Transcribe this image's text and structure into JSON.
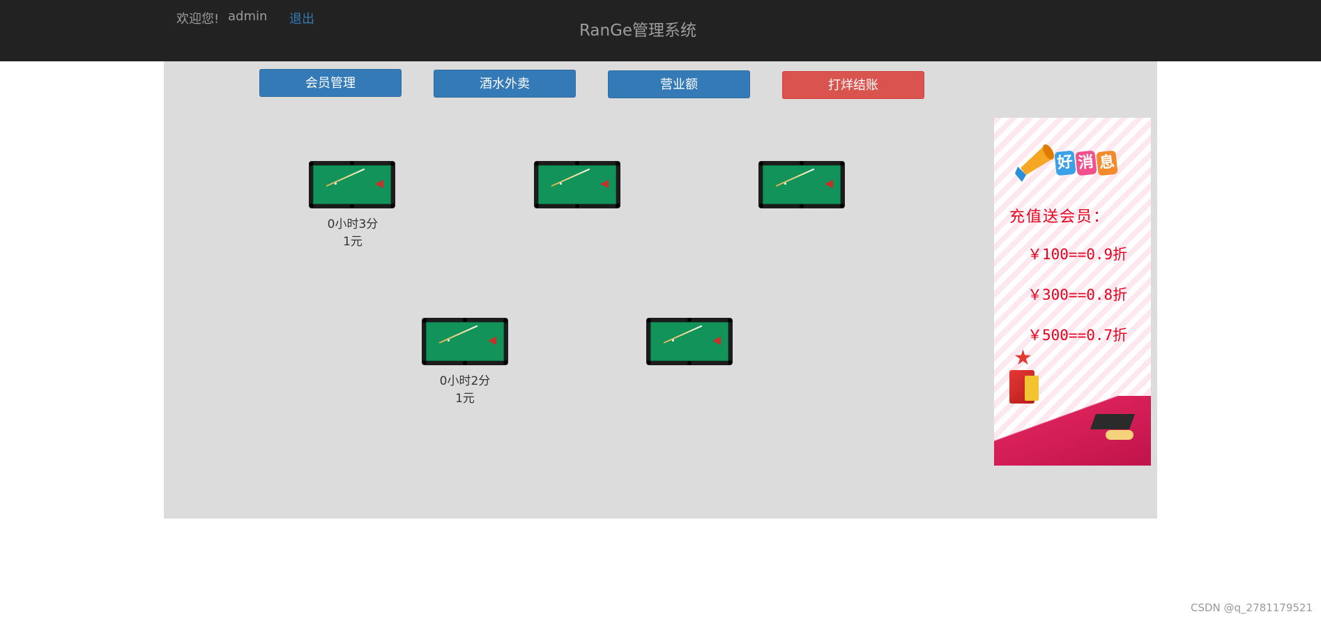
{
  "header": {
    "welcome": "欢迎您!",
    "username": "admin",
    "logout_label": "退出",
    "app_title": "RanGe管理系统"
  },
  "nav": {
    "members_label": "会员管理",
    "drinks_label": "酒水外卖",
    "revenue_label": "营业额",
    "close_label": "打烊结账",
    "colors": {
      "primary": "#337ab7",
      "danger": "#d9534f"
    }
  },
  "tables": [
    {
      "time": "0小时3分",
      "cost": "1元"
    },
    {
      "time": "",
      "cost": ""
    },
    {
      "time": "",
      "cost": ""
    },
    {
      "time": "0小时2分",
      "cost": "1元"
    },
    {
      "time": "",
      "cost": ""
    }
  ],
  "promo": {
    "banner": [
      "好",
      "消",
      "息"
    ],
    "heading": "充值送会员：",
    "offers": [
      "￥100==0.9折",
      "￥300==0.8折",
      "￥500==0.7折"
    ],
    "accent": "#e8001c"
  },
  "watermark": "CSDN @q_2781179521"
}
